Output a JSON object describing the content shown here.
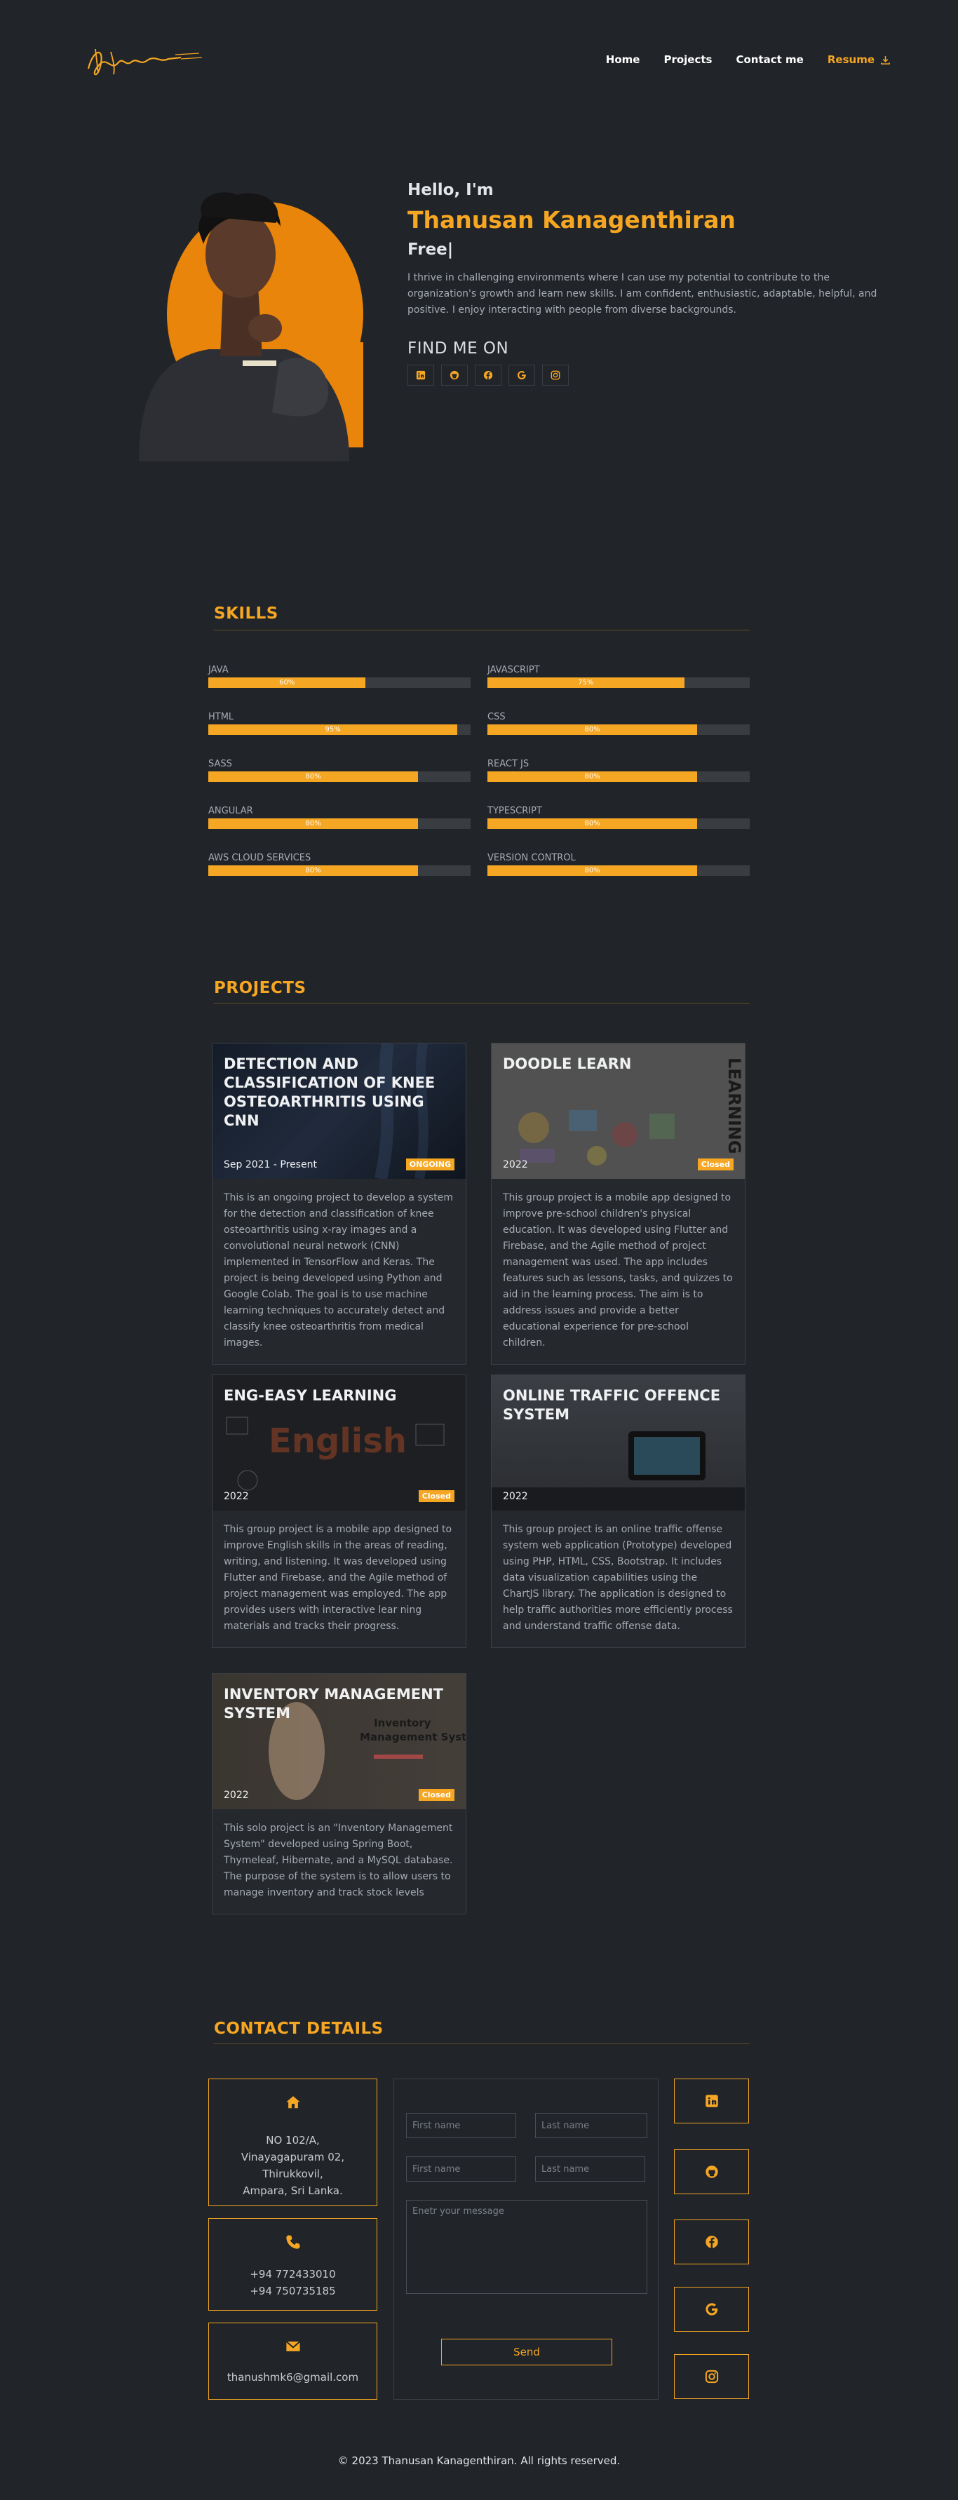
{
  "nav": {
    "links": [
      "Home",
      "Projects",
      "Contact me"
    ],
    "resume": "Resume"
  },
  "hero": {
    "hello": "Hello, I'm",
    "name": "Thanusan Kanagenthiran",
    "typed": "Free|",
    "bio": "I thrive in challenging environments where I can use my potential to contribute to the organization's growth and learn new skills. I am confident, enthusiastic, adaptable, helpful, and positive. I enjoy interacting with people from diverse backgrounds.",
    "find_me": "FIND ME ON",
    "socials": [
      "linkedin-icon",
      "github-icon",
      "facebook-icon",
      "google-icon",
      "instagram-icon"
    ]
  },
  "skills": {
    "title": "SKILLS",
    "items": [
      {
        "name": "JAVA",
        "percent": 60,
        "label": "60%"
      },
      {
        "name": "JAVASCRIPT",
        "percent": 75,
        "label": "75%"
      },
      {
        "name": "HTML",
        "percent": 95,
        "label": "95%"
      },
      {
        "name": "CSS",
        "percent": 80,
        "label": "80%"
      },
      {
        "name": "SASS",
        "percent": 80,
        "label": "80%"
      },
      {
        "name": "REACT JS",
        "percent": 80,
        "label": "80%"
      },
      {
        "name": "ANGULAR",
        "percent": 80,
        "label": "80%"
      },
      {
        "name": "TYPESCRIPT",
        "percent": 80,
        "label": "80%"
      },
      {
        "name": "AWS CLOUD SERVICES",
        "percent": 80,
        "label": "80%"
      },
      {
        "name": "VERSION CONTROL",
        "percent": 80,
        "label": "80%"
      }
    ]
  },
  "projects": {
    "title": "PROJECTS",
    "items": [
      {
        "title": "DETECTION AND CLASSIFICATION OF KNEE OSTEOARTHRITIS USING CNN",
        "date": "Sep 2021 - Present",
        "status": "ONGOING",
        "desc": "This is an ongoing project to develop a system for the detection and classification of knee osteoarthritis using x-ray images and a convolutional neural network (CNN) implemented in TensorFlow and Keras. The project is being developed using Python and Google Colab. The goal is to use machine learning techniques to accurately detect and classify knee osteoarthritis from medical images."
      },
      {
        "title": "DOODLE LEARN",
        "date": "2022",
        "status": "Closed",
        "desc": "This group project is a mobile app designed to improve pre-school children's physical education. It was developed using Flutter and Firebase, and the Agile method of project management was used. The app includes features such as lessons, tasks, and quizzes to aid in the learning process. The aim is to address issues and provide a better educational experience for pre-school children."
      },
      {
        "title": "ENG-EASY LEARNING",
        "date": "2022",
        "status": "Closed",
        "desc": "This group project is a mobile app designed to improve English skills in the areas of reading, writing, and listening. It was developed using Flutter and Firebase, and the Agile method of project management was employed. The app provides users with interactive lear ning materials and tracks their progress."
      },
      {
        "title": "ONLINE TRAFFIC OFFENCE SYSTEM",
        "date": "2022",
        "status": "",
        "desc": "This group project is an online traffic offense system web application (Prototype) developed using PHP, HTML, CSS, Bootstrap. It includes data visualization capabilities using the ChartJS library. The application is designed to help traffic authorities more efficiently process and understand traffic offense data."
      },
      {
        "title": "INVENTORY MANAGEMENT SYSTEM",
        "date": "2022",
        "status": "Closed",
        "desc": "This solo project is an \"Inventory Management System\" developed using Spring Boot, Thymeleaf, Hibernate, and a MySQL database. The purpose of the system is to allow users to manage inventory and track stock levels"
      }
    ],
    "image_texts": {
      "doodle": "LEARNING",
      "english": "English",
      "inventory_line1": "Inventory",
      "inventory_line2": "Management System"
    }
  },
  "contact": {
    "title": "CONTACT DETAILS",
    "address": [
      "NO 102/A,",
      "Vinayagapuram 02,",
      "Thirukkovil,",
      "Ampara, Sri Lanka."
    ],
    "phones": [
      "+94 772433010",
      "+94 750735185"
    ],
    "email": "thanushmk6@gmail.com",
    "form": {
      "first_name": "First name",
      "last_name": "Last name",
      "message": "Enetr your message",
      "send": "Send"
    }
  },
  "footer": "© 2023 Thanusan Kanagenthiran. All rights reserved.",
  "colors": {
    "accent": "#f5a623",
    "background": "#212428"
  }
}
